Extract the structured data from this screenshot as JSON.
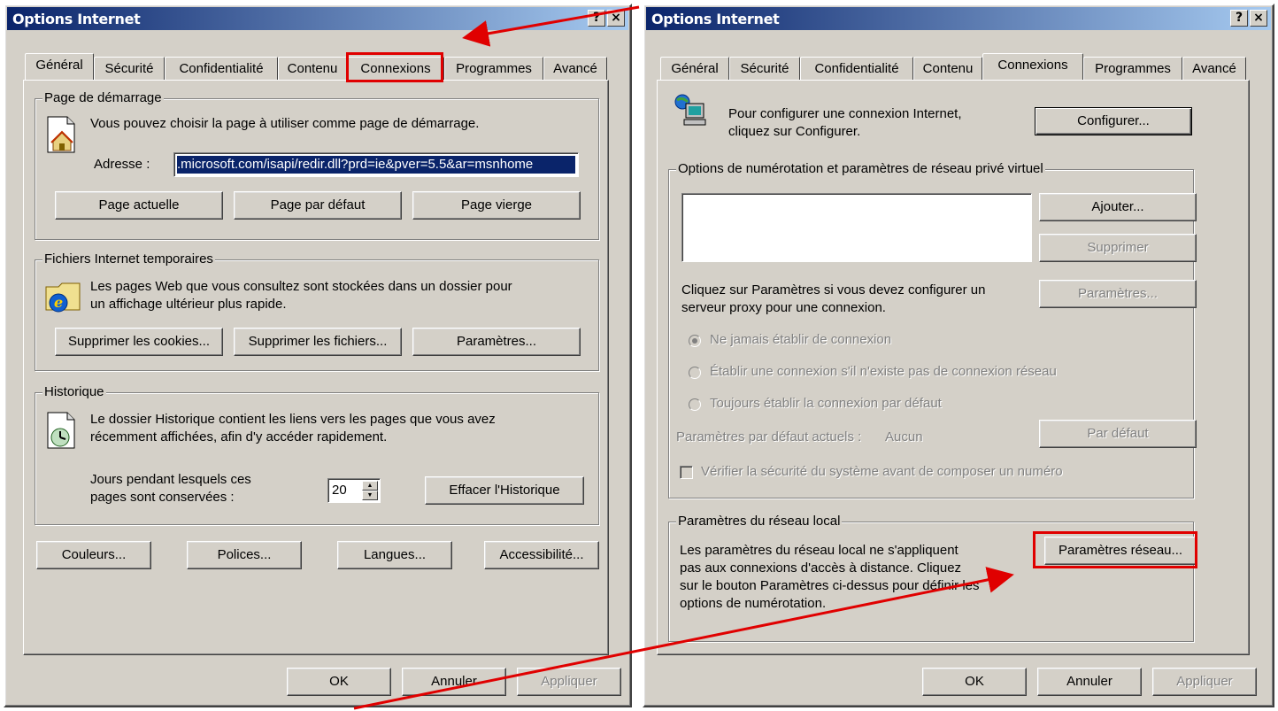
{
  "left": {
    "title": "Options Internet",
    "help": "?",
    "close": "×",
    "tabs": [
      "Général",
      "Sécurité",
      "Confidentialité",
      "Contenu",
      "Connexions",
      "Programmes",
      "Avancé"
    ],
    "home": {
      "legend": "Page de démarrage",
      "desc": "Vous pouvez choisir la page à utiliser comme page de démarrage.",
      "addr_label": "Adresse :",
      "addr_value": ".microsoft.com/isapi/redir.dll?prd=ie&pver=5.5&ar=msnhome",
      "btn_current": "Page actuelle",
      "btn_default": "Page par défaut",
      "btn_blank": "Page vierge"
    },
    "temp": {
      "legend": "Fichiers Internet temporaires",
      "desc1": "Les pages Web que vous consultez sont stockées dans un dossier pour",
      "desc2": "un affichage ultérieur plus rapide.",
      "btn_cookies": "Supprimer les cookies...",
      "btn_files": "Supprimer les fichiers...",
      "btn_params": "Paramètres..."
    },
    "history": {
      "legend": "Historique",
      "desc1": "Le dossier Historique contient les liens vers les pages que vous avez",
      "desc2": "récemment affichées, afin d'y accéder rapidement.",
      "days1": "Jours pendant lesquels ces",
      "days2": "pages sont conservées :",
      "days_value": "20",
      "btn_clear": "Effacer l'Historique"
    },
    "btn_colors": "Couleurs...",
    "btn_fonts": "Polices...",
    "btn_langs": "Langues...",
    "btn_access": "Accessibilité...",
    "ok": "OK",
    "cancel": "Annuler",
    "apply": "Appliquer"
  },
  "right": {
    "title": "Options Internet",
    "help": "?",
    "close": "×",
    "tabs": [
      "Général",
      "Sécurité",
      "Confidentialité",
      "Contenu",
      "Connexions",
      "Programmes",
      "Avancé"
    ],
    "config1": "Pour configurer une connexion Internet,",
    "config2": "cliquez sur Configurer.",
    "btn_config": "Configurer...",
    "dial": {
      "legend": "Options de numérotation et paramètres de réseau privé virtuel",
      "btn_add": "Ajouter...",
      "btn_remove": "Supprimer",
      "proxy1": "Cliquez sur Paramètres si vous devez configurer un",
      "proxy2": "serveur proxy pour une connexion.",
      "btn_params": "Paramètres...",
      "radio1": "Ne jamais établir de connexion",
      "radio2": "Établir une connexion s'il n'existe pas de connexion réseau",
      "radio3": "Toujours établir la connexion par défaut",
      "current_label": "Paramètres par défaut actuels :",
      "current_value": "Aucun",
      "btn_default": "Par défaut",
      "check": "Vérifier la sécurité du système avant de composer un numéro"
    },
    "lan": {
      "legend": "Paramètres du réseau local",
      "desc1": "Les paramètres du réseau local ne s'appliquent",
      "desc2": "pas aux connexions d'accès à distance. Cliquez",
      "desc3": "sur le bouton Paramètres ci-dessus pour définir les",
      "desc4": "options de numérotation.",
      "btn_lan": "Paramètres réseau..."
    },
    "ok": "OK",
    "cancel": "Annuler",
    "apply": "Appliquer"
  },
  "colors": {
    "highlight": "#e00000",
    "titlebar": "#0a246a",
    "face": "#d4d0c8"
  }
}
